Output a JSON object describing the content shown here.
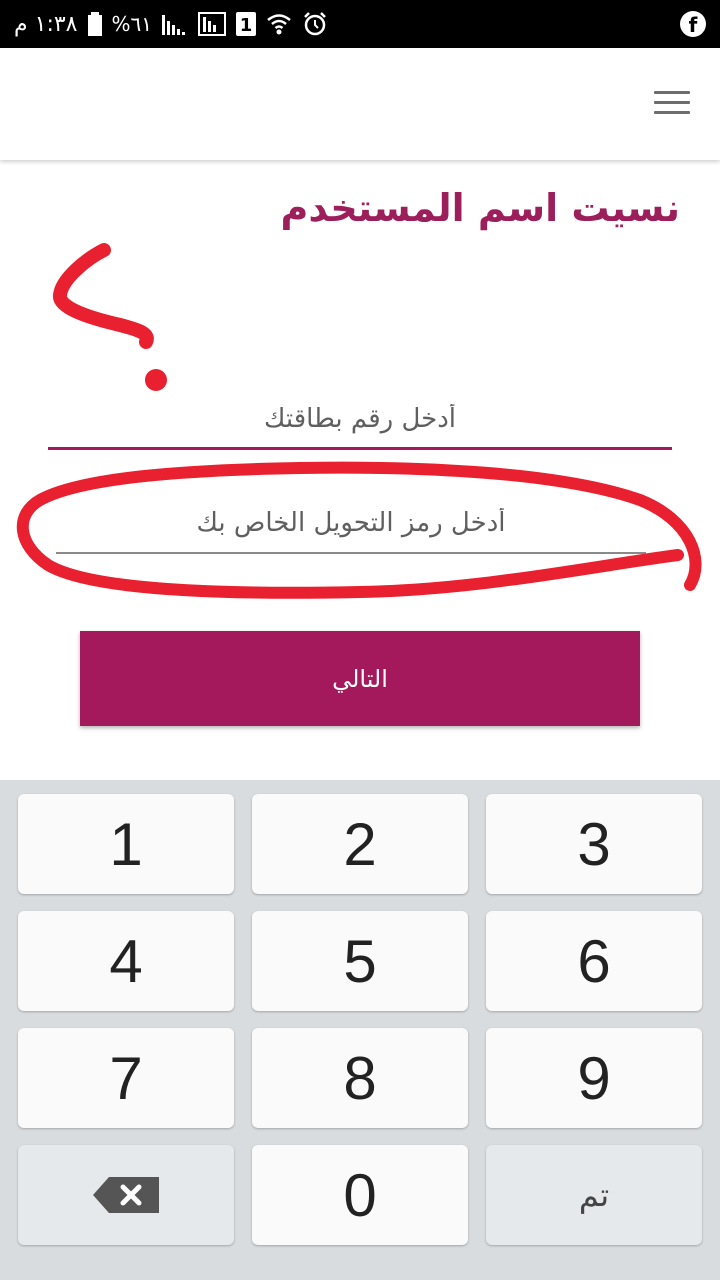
{
  "status_bar": {
    "time": "١:٣٨ م",
    "battery": "%٦١",
    "sim_slot": "1",
    "notification_app": "f"
  },
  "page": {
    "title": "نسيت اسم المستخدم",
    "card_placeholder": "أدخل رقم بطاقتك",
    "transfer_placeholder": "أدخل رمز التحويل الخاص بك",
    "next_label": "التالي"
  },
  "colors": {
    "accent": "#a3195b",
    "title": "#9c1f5c",
    "annotation": "#e8202f"
  },
  "keyboard": {
    "rows": [
      [
        "1",
        "2",
        "3"
      ],
      [
        "4",
        "5",
        "6"
      ],
      [
        "7",
        "8",
        "9"
      ]
    ],
    "zero": "0",
    "done": "تم",
    "backspace_icon": "backspace-icon"
  }
}
